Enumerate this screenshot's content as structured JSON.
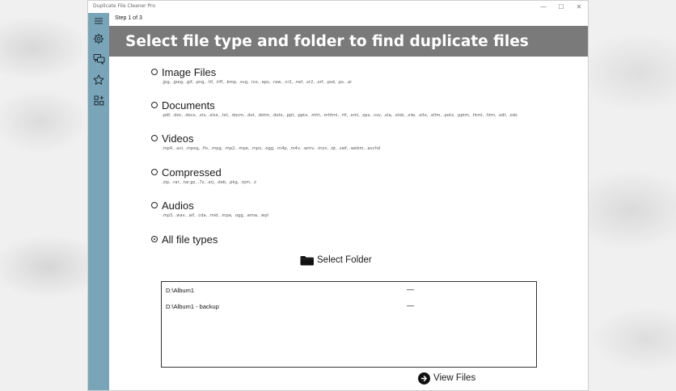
{
  "window": {
    "title": "Duplicate File Cleaner Pro",
    "controls": [
      "—",
      "☐",
      "✕"
    ]
  },
  "step": {
    "label": "Step 1 of 3"
  },
  "header": {
    "title": "Select file type and folder to find duplicate files"
  },
  "sidebar": {
    "items": [
      {
        "icon": "menu-icon"
      },
      {
        "icon": "gear-icon"
      },
      {
        "icon": "chat-icon"
      },
      {
        "icon": "star-icon"
      },
      {
        "icon": "apps-icon"
      }
    ]
  },
  "file_types": [
    {
      "label": "Image Files",
      "extensions": ".jpg, .jpeg, .gif, .png, .tif, .tiff, .bmp, .svg, .ico, .eps, .raw, .cr2, .nef, .sr2, .orf, .psd, .ps, .ai",
      "checked": false
    },
    {
      "label": "Documents",
      "extensions": ".pdf, .doc, .docx, .xls, .xlsx, .txt, .docm, .dot, .dotm, .dotx, .ppt, .pptx, .mht, .mhtml, .rtf, .xml, .xps, .csv, .xla, .xlsb, .xlw, .xltx, .xltm, .potx, .pptm, .html, .htm, .odt, .ods",
      "checked": false
    },
    {
      "label": "Videos",
      "extensions": ".mp4, .avi, .mpeg, .flv, .mpg, .mp2, .mpe, .mpv, .ogg, .m4p, .m4v, .wmv, .mov, .qt, .swf, .webm, .avchd",
      "checked": false
    },
    {
      "label": "Compressed",
      "extensions": ".zip, .rar, .tar.gz, .7z, .arj, .deb, .pkg, .rpm, .z",
      "checked": false
    },
    {
      "label": "Audios",
      "extensions": ".mp3, .wav, .aif, .cda, .mid, .mpa, .ogg, .wma, .wpl",
      "checked": false
    },
    {
      "label": "All file types",
      "extensions": "",
      "checked": true
    }
  ],
  "select_folder": {
    "label": "Select Folder"
  },
  "folders": [
    {
      "path": "D:\\Album1",
      "remove": "—"
    },
    {
      "path": "D:\\Album1 - backup",
      "remove": "—"
    }
  ],
  "view_files": {
    "label": "View Files"
  }
}
